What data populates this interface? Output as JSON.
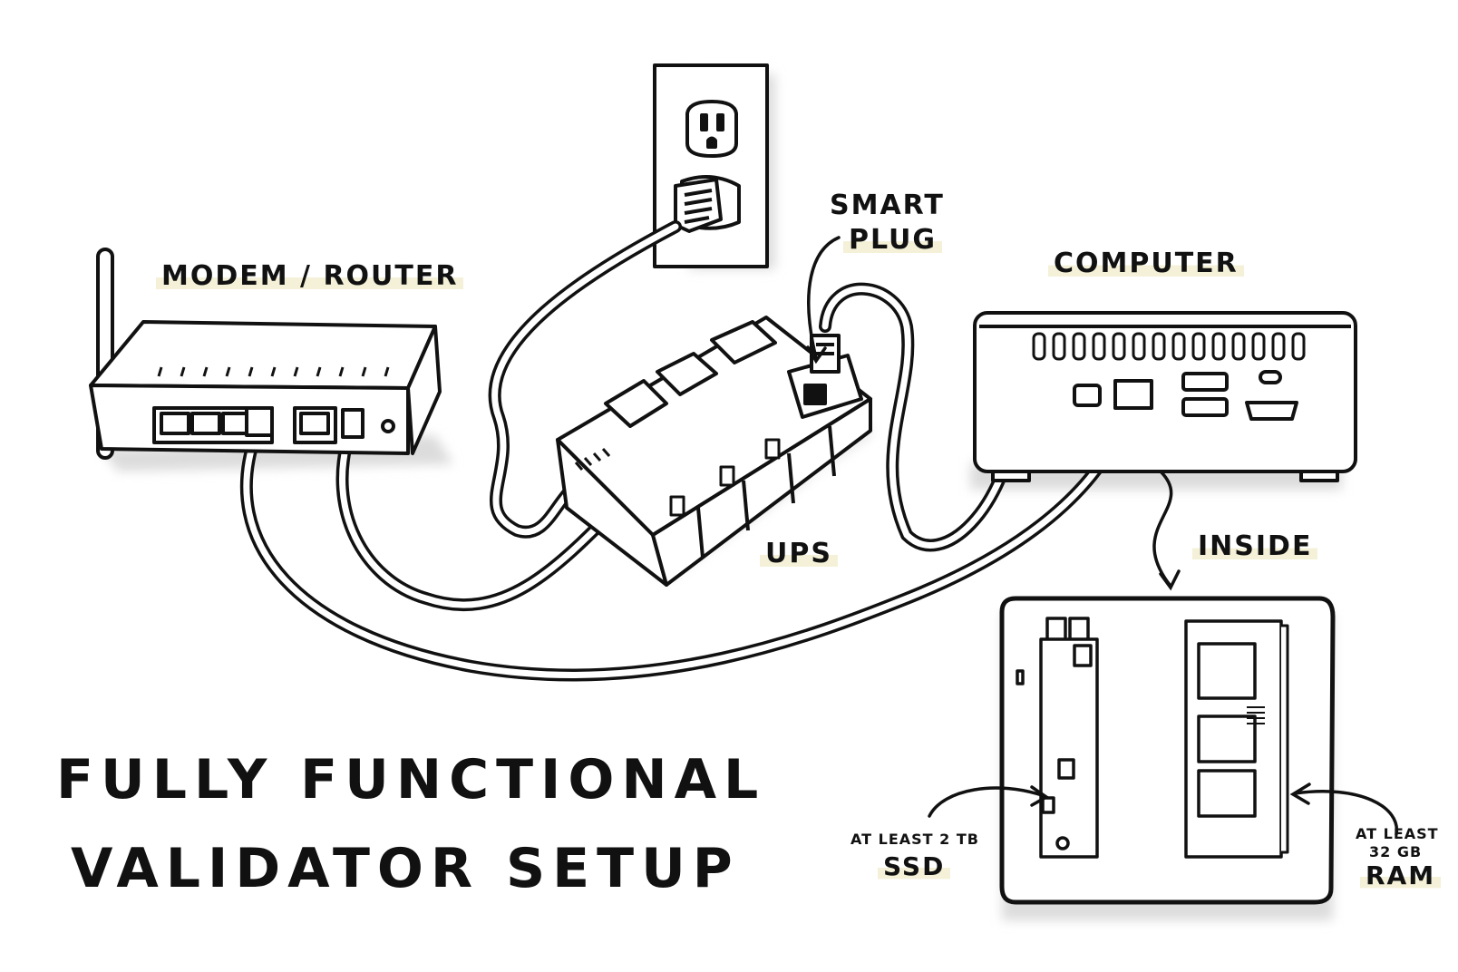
{
  "labels": {
    "modem_router": "MODEM / ROUTER",
    "smart_plug_1": "SMART",
    "smart_plug_2": "PLUG",
    "computer": "COMPUTER",
    "ups": "UPS",
    "inside": "INSIDE",
    "ssd_note": "AT LEAST 2 TB",
    "ssd": "SSD",
    "ram_note_1": "AT LEAST",
    "ram_note_2": "32 GB",
    "ram": "RAM"
  },
  "title": {
    "line1": "FULLY FUNCTIONAL",
    "line2": "VALIDATOR SETUP"
  },
  "colors": {
    "ink": "#111111",
    "shadow": "#e3e3e3",
    "highlight": "#f4f1d8",
    "paper": "#ffffff"
  },
  "icons": [
    "wall-outlet-icon",
    "router-icon",
    "ups-icon",
    "smart-plug-icon",
    "computer-icon",
    "ssd-icon",
    "ram-icon"
  ]
}
